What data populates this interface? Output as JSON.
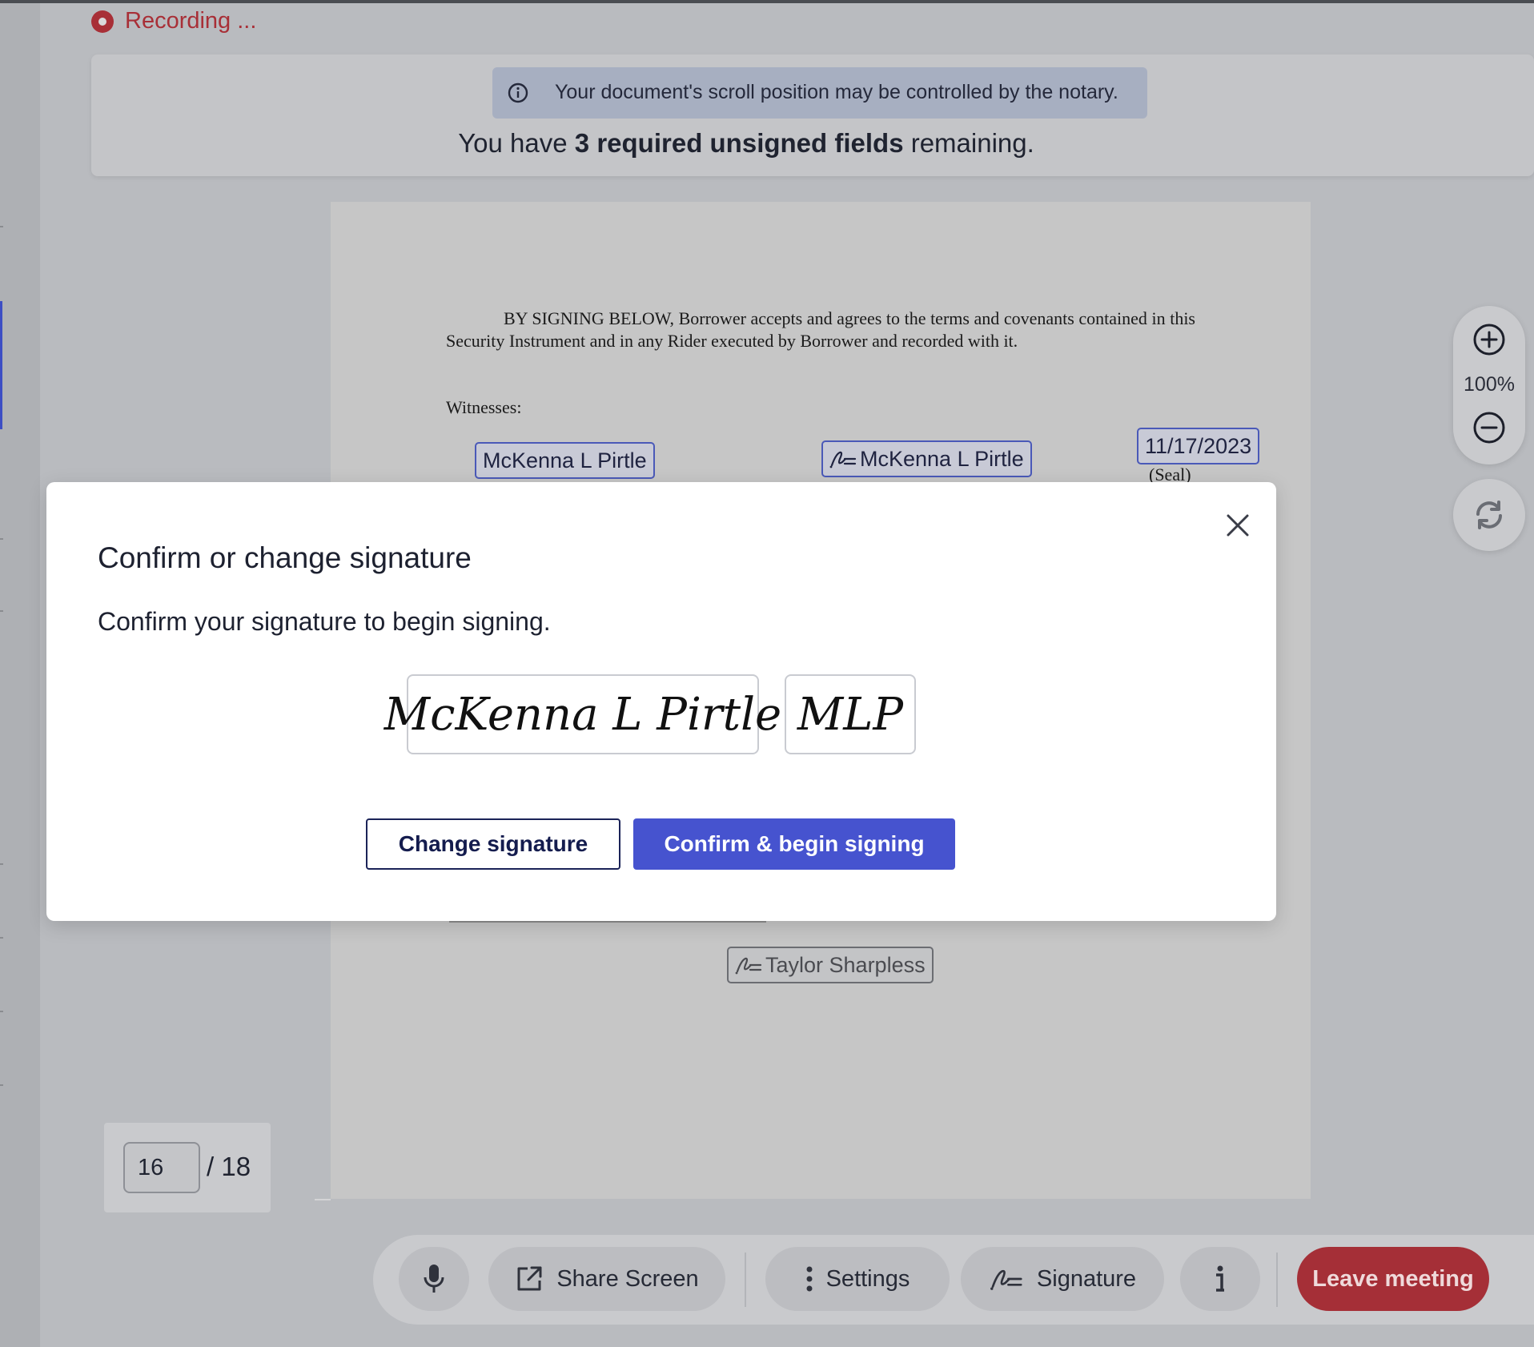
{
  "recording": {
    "label": "Recording ..."
  },
  "notice": {
    "scroll_message": "Your document's scroll position may be controlled by the notary.",
    "remaining_prefix": "You have ",
    "remaining_bold": "3 required unsigned fields",
    "remaining_suffix": " remaining."
  },
  "document": {
    "paragraph": "BY SIGNING BELOW, Borrower accepts and agrees to the terms and covenants contained in this Security Instrument and in any Rider executed by Borrower and recorded with it.",
    "witnesses_label": "Witnesses:",
    "witness_field": "McKenna L Pirtle",
    "signature_field": "McKenna L Pirtle",
    "date_field": "11/17/2023",
    "seal_label": "(Seal)",
    "second_signature_field": "Taylor Sharpless"
  },
  "zoom": {
    "level": "100%"
  },
  "pagination": {
    "current_page": "16",
    "total": "/ 18"
  },
  "toolbar": {
    "share_screen": "Share Screen",
    "settings": "Settings",
    "signature": "Signature",
    "leave_meeting": "Leave meeting"
  },
  "modal": {
    "title": "Confirm or change signature",
    "description": "Confirm your signature to begin signing.",
    "signature_full": "McKenna L Pirtle",
    "signature_initials": "MLP",
    "change_button": "Change signature",
    "confirm_button": "Confirm & begin signing"
  },
  "colors": {
    "accent": "#4653cf",
    "recording": "#a82f37",
    "leave_button": "#a52f37"
  },
  "icons": [
    "record-icon",
    "info-icon",
    "signature-icon",
    "zoom-in-icon",
    "zoom-out-icon",
    "refresh-icon",
    "microphone-icon",
    "share-screen-icon",
    "more-vertical-icon",
    "info-i-icon",
    "close-icon"
  ]
}
